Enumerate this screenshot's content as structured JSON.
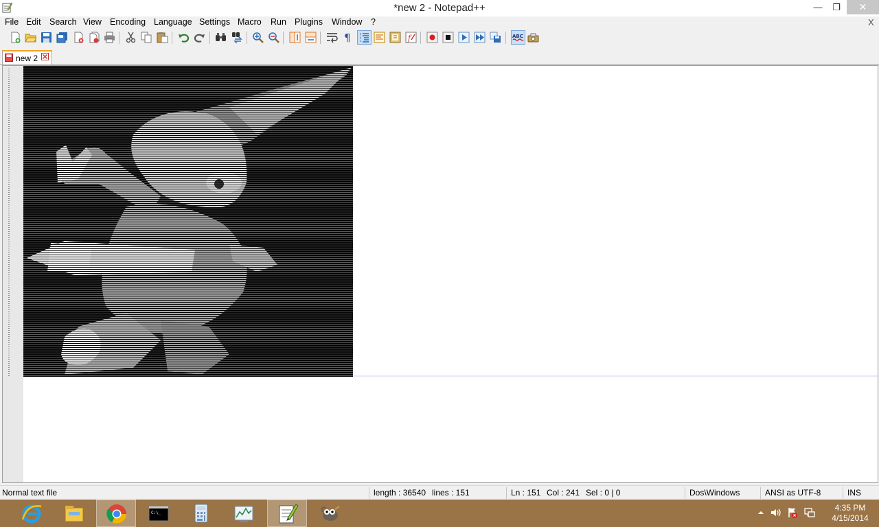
{
  "window": {
    "title": "*new  2 - Notepad++",
    "min_glyph": "—",
    "max_glyph": "❐",
    "close_glyph": "✕"
  },
  "menu": {
    "items": [
      "File",
      "Edit",
      "Search",
      "View",
      "Encoding",
      "Language",
      "Settings",
      "Macro",
      "Run",
      "Plugins",
      "Window",
      "?"
    ],
    "close_glyph": "X"
  },
  "toolbar": {
    "buttons": [
      {
        "name": "new-file-icon"
      },
      {
        "name": "open-file-icon"
      },
      {
        "name": "save-icon"
      },
      {
        "name": "save-all-icon"
      },
      {
        "name": "close-icon"
      },
      {
        "name": "close-all-icon"
      },
      {
        "name": "print-icon"
      },
      {
        "name": "cut-icon"
      },
      {
        "name": "copy-icon"
      },
      {
        "name": "paste-icon"
      },
      {
        "name": "undo-icon"
      },
      {
        "name": "redo-icon"
      },
      {
        "name": "find-icon"
      },
      {
        "name": "replace-icon"
      },
      {
        "name": "zoom-in-icon"
      },
      {
        "name": "zoom-out-icon"
      },
      {
        "name": "sync-vertical-icon"
      },
      {
        "name": "sync-horizontal-icon"
      },
      {
        "name": "word-wrap-icon"
      },
      {
        "name": "show-all-chars-icon"
      },
      {
        "name": "indent-guide-icon"
      },
      {
        "name": "user-language-icon"
      },
      {
        "name": "doc-map-icon"
      },
      {
        "name": "function-list-icon"
      },
      {
        "name": "record-macro-icon"
      },
      {
        "name": "stop-macro-icon"
      },
      {
        "name": "play-macro-icon"
      },
      {
        "name": "play-multiple-macro-icon"
      },
      {
        "name": "save-macro-icon"
      },
      {
        "name": "spell-check-icon"
      },
      {
        "name": "plugin-icon"
      }
    ]
  },
  "tabs": [
    {
      "label": "new  2",
      "active": true,
      "modified": true
    }
  ],
  "editor": {
    "content_kind": "ascii-art",
    "line_count_visible": 151
  },
  "status": {
    "file_type": "Normal text file",
    "length": "length : 36540",
    "lines": "lines : 151",
    "ln": "Ln : 151",
    "col": "Col : 241",
    "sel": "Sel : 0 | 0",
    "eol": "Dos\\Windows",
    "encoding": "ANSI as UTF-8",
    "mode": "INS"
  },
  "taskbar": {
    "apps": [
      {
        "name": "internet-explorer-icon",
        "active": false
      },
      {
        "name": "file-explorer-icon",
        "active": false
      },
      {
        "name": "chrome-icon",
        "active": true
      },
      {
        "name": "command-prompt-icon",
        "active": false
      },
      {
        "name": "calculator-icon",
        "active": false
      },
      {
        "name": "resource-monitor-icon",
        "active": false
      },
      {
        "name": "notepad-plus-plus-icon",
        "active": true
      },
      {
        "name": "gimp-icon",
        "active": false
      }
    ],
    "tray": [
      "show-hidden-icons-icon",
      "volume-icon",
      "action-center-icon",
      "network-icon"
    ],
    "time": "4:35 PM",
    "date": "4/15/2014"
  },
  "colors": {
    "taskbar": "#9a7446",
    "tab_accent": "#f4a224",
    "ascii_background": "#000000"
  }
}
